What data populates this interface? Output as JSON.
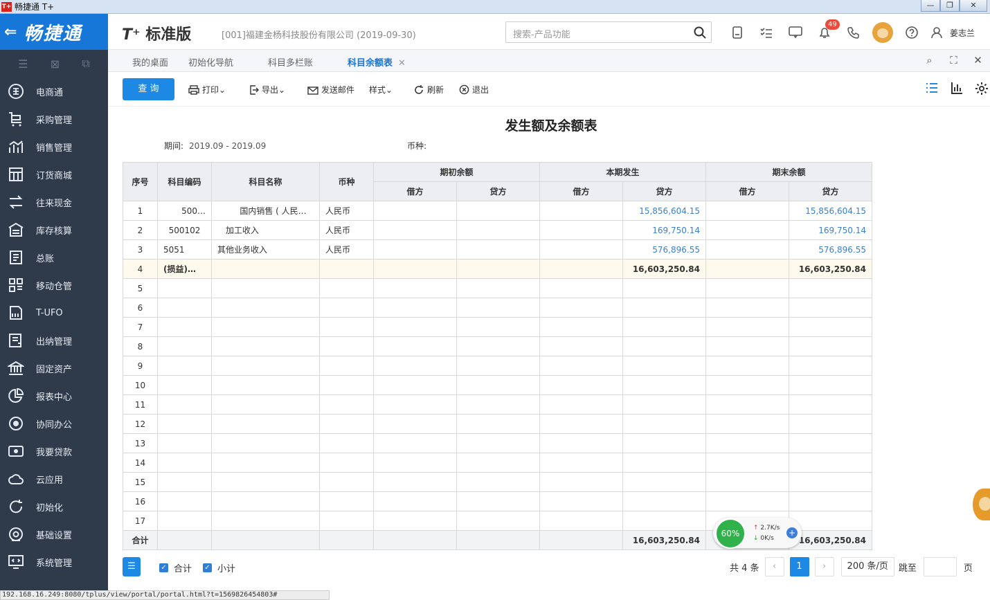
{
  "window": {
    "title": "畅捷通 T+",
    "logo": "T+",
    "min": "▭",
    "restore": "❐",
    "close": "✕"
  },
  "brand": {
    "text": "畅捷通"
  },
  "sidebar": {
    "items": [
      {
        "label": "电商通",
        "icon": "e-commerce-icon"
      },
      {
        "label": "采购管理",
        "icon": "cart-icon"
      },
      {
        "label": "销售管理",
        "icon": "sales-chart-icon"
      },
      {
        "label": "订货商城",
        "icon": "store-icon"
      },
      {
        "label": "往来现金",
        "icon": "exchange-icon"
      },
      {
        "label": "库存核算",
        "icon": "warehouse-icon"
      },
      {
        "label": "总账",
        "icon": "ledger-icon"
      },
      {
        "label": "移动仓管",
        "icon": "grid-icon"
      },
      {
        "label": "T-UFO",
        "icon": "ufo-icon"
      },
      {
        "label": "出纳管理",
        "icon": "cashier-icon"
      },
      {
        "label": "固定资产",
        "icon": "bank-icon"
      },
      {
        "label": "报表中心",
        "icon": "pie-chart-icon"
      },
      {
        "label": "协同办公",
        "icon": "collab-icon"
      },
      {
        "label": "我要贷款",
        "icon": "money-icon"
      },
      {
        "label": "云应用",
        "icon": "cloud-icon"
      },
      {
        "label": "初始化",
        "icon": "refresh-icon"
      },
      {
        "label": "基础设置",
        "icon": "settings-icon"
      },
      {
        "label": "系统管理",
        "icon": "system-icon"
      }
    ]
  },
  "header": {
    "product": "标准版",
    "company": "[001]福建金杨科技股份有限公司  (2019-09-30)",
    "search_placeholder": "搜索-产品功能",
    "notification_count": "49",
    "user": "姜志兰"
  },
  "tabs": [
    {
      "label": "我的桌面"
    },
    {
      "label": "初始化导航"
    },
    {
      "label": "科目多栏账"
    },
    {
      "label": "科目余额表",
      "active": true
    }
  ],
  "toolbar": {
    "query": "查 询",
    "print": "打印",
    "export": "导出",
    "email": "发送邮件",
    "style": "样式",
    "refresh": "刷新",
    "exit": "退出"
  },
  "report": {
    "title": "发生额及余额表",
    "period_label": "期间:",
    "period_value": "2019.09 - 2019.09",
    "currency_label": "币种:",
    "headers": {
      "seq": "序号",
      "code": "科目编码",
      "name": "科目名称",
      "currency": "币种",
      "opening": "期初余额",
      "current": "本期发生",
      "closing": "期末余额",
      "debit": "借方",
      "credit": "贷方"
    },
    "rows": [
      {
        "seq": "1",
        "code": "500…",
        "name": "国内销售 ( 人民…",
        "currency": "人民币",
        "cur_credit": "15,856,604.15",
        "close_credit": "15,856,604.15"
      },
      {
        "seq": "2",
        "code": "500102",
        "name": "加工收入",
        "currency": "人民币",
        "cur_credit": "169,750.14",
        "close_credit": "169,750.14"
      },
      {
        "seq": "3",
        "code": "5051",
        "name": "其他业务收入",
        "currency": "人民币",
        "cur_credit": "576,896.55",
        "close_credit": "576,896.55"
      },
      {
        "seq": "4",
        "code": "(损益)…",
        "name": "",
        "currency": "",
        "cur_credit": "16,603,250.84",
        "close_credit": "16,603,250.84"
      },
      {
        "seq": "5"
      },
      {
        "seq": "6"
      },
      {
        "seq": "7"
      },
      {
        "seq": "8"
      },
      {
        "seq": "9"
      },
      {
        "seq": "10"
      },
      {
        "seq": "11"
      },
      {
        "seq": "12"
      },
      {
        "seq": "13"
      },
      {
        "seq": "14"
      },
      {
        "seq": "15"
      },
      {
        "seq": "16"
      },
      {
        "seq": "17"
      }
    ],
    "total": {
      "label": "合计",
      "cur_credit": "16,603,250.84",
      "close_credit": "16,603,250.84"
    }
  },
  "footer": {
    "total_check": "合计",
    "subtotal_check": "小计",
    "count": "共 4 条",
    "page": "1",
    "page_size": "200 条/页",
    "jump": "跳至",
    "page_unit": "页"
  },
  "speed": {
    "percent": "60%",
    "up": "2.7K/s",
    "down": "0K/s"
  },
  "status_url": "192.168.16.249:8080/tplus/view/portal/portal.html?t=1569826454803#"
}
